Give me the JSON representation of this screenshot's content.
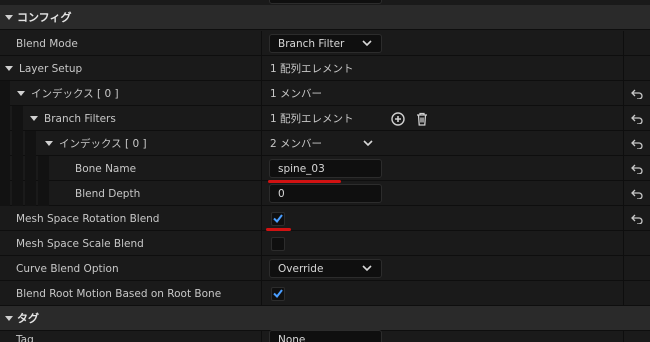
{
  "sections": {
    "config": {
      "label": "コンフィグ"
    },
    "tag": {
      "label": "タグ"
    }
  },
  "rows": {
    "blend_mode": {
      "label": "Blend Mode",
      "value": "Branch Filter"
    },
    "layer_setup": {
      "label": "Layer Setup",
      "value": "1 配列エレメント"
    },
    "index0": {
      "label": "インデックス [ 0 ]",
      "value": "1 メンバー"
    },
    "branch_filters": {
      "label": "Branch Filters",
      "value": "1 配列エレメント"
    },
    "index0_inner": {
      "label": "インデックス [ 0 ]",
      "value": "2 メンバー"
    },
    "bone_name": {
      "label": "Bone Name",
      "value": "spine_03"
    },
    "blend_depth": {
      "label": "Blend Depth",
      "value": "0"
    },
    "mesh_space_rotation": {
      "label": "Mesh Space Rotation Blend",
      "checked": true
    },
    "mesh_space_scale": {
      "label": "Mesh Space Scale Blend",
      "checked": false
    },
    "curve_blend_option": {
      "label": "Curve Blend Option",
      "value": "Override"
    },
    "blend_root_motion": {
      "label": "Blend Root Motion Based on Root Bone",
      "checked": true
    },
    "tag": {
      "label": "Tag",
      "value": "None"
    }
  },
  "colors": {
    "panel_bg": "#1a1a1a",
    "category_bg": "#2a2a2a",
    "input_bg": "#0f0f0f",
    "check_blue": "#4a9eff",
    "annotation_red": "#d11212"
  },
  "icons": {
    "reset": "reset-arrow-icon",
    "add": "add-circle-icon",
    "delete": "trash-icon",
    "dropdown": "chevron-down-icon"
  }
}
